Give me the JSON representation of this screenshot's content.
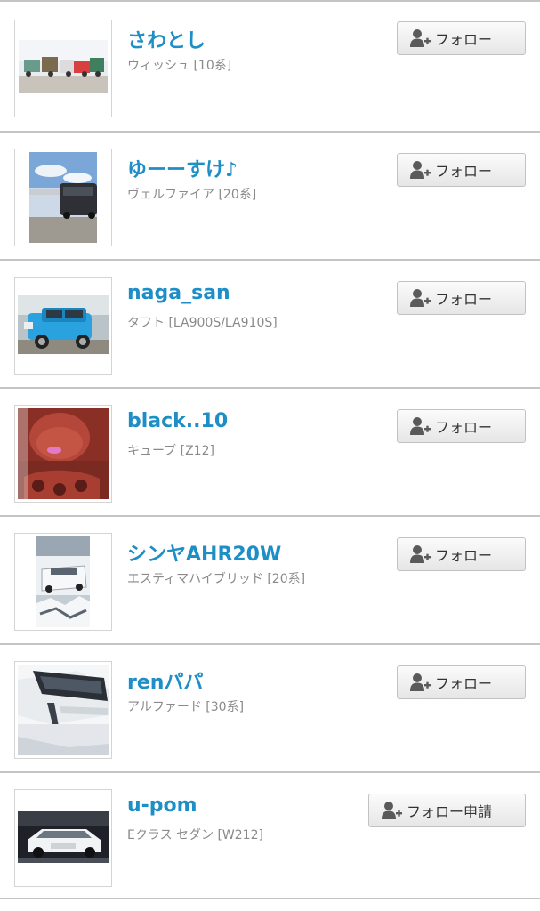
{
  "users": [
    {
      "name": "さわとし",
      "car": "ウィッシュ [10系]",
      "button": "フォロー"
    },
    {
      "name": "ゆーーすけ♪",
      "car": "ヴェルファイア [20系]",
      "button": "フォロー"
    },
    {
      "name": "naga_san",
      "car": "タフト [LA900S/LA910S]",
      "button": "フォロー"
    },
    {
      "name": "black..10",
      "car": "キューブ [Z12]",
      "button": "フォロー"
    },
    {
      "name": "シンヤAHR20W",
      "car": "エスティマハイブリッド [20系]",
      "button": "フォロー"
    },
    {
      "name": "renパパ",
      "car": "アルファード [30系]",
      "button": "フォロー"
    },
    {
      "name": "u-pom",
      "car": "Eクラス セダン [W212]",
      "button": "フォロー申請"
    }
  ],
  "icons": {
    "button_icon": "add-user-icon",
    "button_icon_color": "#5a5a5a"
  },
  "colors": {
    "username": "#1e8fc6",
    "car_text": "#8a8a8a",
    "divider": "#c4c4c4"
  }
}
